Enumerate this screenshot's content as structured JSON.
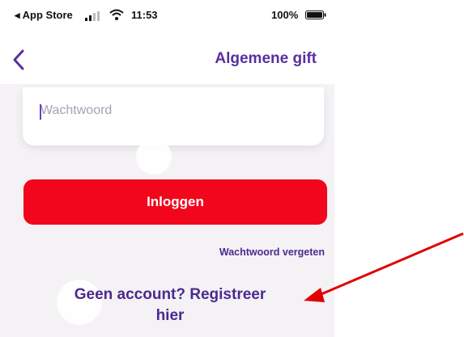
{
  "statusbar": {
    "back_label": "◂ App Store",
    "time": "11:53",
    "battery": "100%"
  },
  "navbar": {
    "title": "Algemene gift",
    "back_icon": "chevron-left-icon"
  },
  "password_field": {
    "placeholder": "Wachtwoord",
    "value": ""
  },
  "login_button": {
    "label": "Inloggen"
  },
  "forgot_password": {
    "label": "Wachtwoord vergeten"
  },
  "register_link": {
    "line1": "Geen account? Registreer",
    "line2": "hier"
  },
  "colors": {
    "brand_purple": "#5a2fa0",
    "button_red": "#f2061b",
    "annotation_arrow": "#e10000"
  }
}
